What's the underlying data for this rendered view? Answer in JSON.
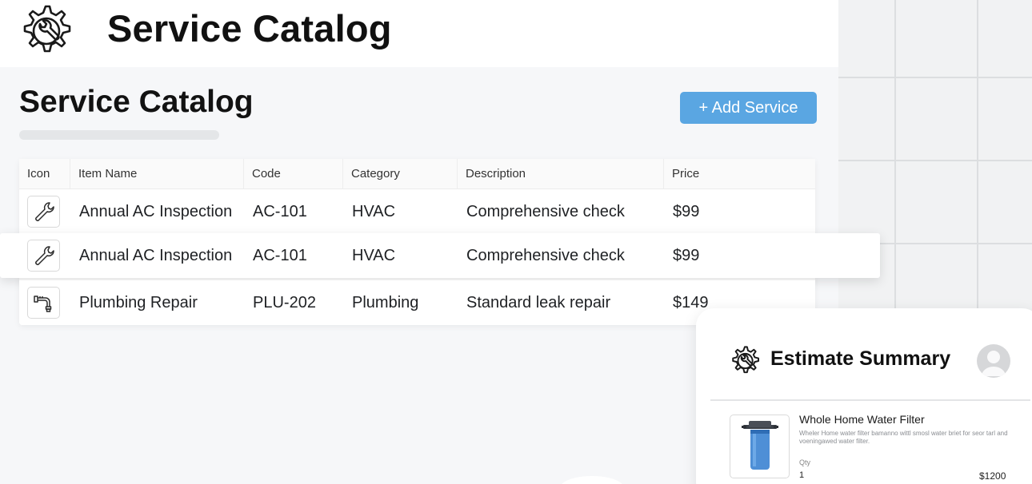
{
  "header": {
    "title": "Service Catalog",
    "logo_icon": "gear-wrench-icon"
  },
  "page": {
    "title": "Service Catalog",
    "add_button_label": "+ Add Service",
    "accent_color": "#5aa6e2"
  },
  "table": {
    "columns": [
      "Icon",
      "Item Name",
      "Code",
      "Category",
      "Description",
      "Price"
    ],
    "rows": [
      {
        "icon": "wrench-icon",
        "name": "Annual AC Inspection",
        "code": "AC-101",
        "category": "HVAC",
        "description": "Comprehensive check",
        "price": "$99"
      },
      {
        "icon": "wrench-icon",
        "name": "Annual AC Inspection",
        "code": "AC-101",
        "category": "HVAC",
        "description": "Comprehensive check",
        "price": "$99"
      },
      {
        "icon": "pipe-faucet-icon",
        "name": "Plumbing Repair",
        "code": "PLU-202",
        "category": "Plumbing",
        "description": "Standard leak repair",
        "price": "$149"
      }
    ]
  },
  "estimate": {
    "title": "Estimate Summary",
    "logo_icon": "gear-wrench-icon",
    "avatar_icon": "user-avatar-icon",
    "item": {
      "name": "Whole Home Water Filter",
      "description": "Wheler Home water filter bamanno wittl smosl water briet for seor tarl and voeningawed water filter.",
      "qty_label": "Qty",
      "qty": "1",
      "price": "$1200",
      "thumb_icon": "water-filter-icon"
    }
  }
}
